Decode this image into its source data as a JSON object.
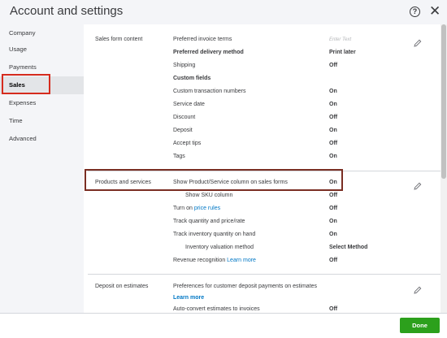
{
  "header": {
    "title": "Account and settings",
    "help_glyph": "?",
    "close_glyph": "✕"
  },
  "sidebar": {
    "items": [
      {
        "label": "Company"
      },
      {
        "label": "Usage"
      },
      {
        "label": "Payments"
      },
      {
        "label": "Sales"
      },
      {
        "label": "Expenses"
      },
      {
        "label": "Time"
      },
      {
        "label": "Advanced"
      }
    ],
    "active": "Sales"
  },
  "sections": {
    "sales_form_content": {
      "title": "Sales form content",
      "rows": [
        {
          "label": "Preferred invoice terms",
          "value": "Enter Text"
        },
        {
          "label": "Preferred delivery method",
          "value": "Print later"
        },
        {
          "label": "Shipping",
          "value": "Off"
        },
        {
          "label": "Custom fields",
          "value": ""
        },
        {
          "label": "Custom transaction numbers",
          "value": "On"
        },
        {
          "label": "Service date",
          "value": "On"
        },
        {
          "label": "Discount",
          "value": "Off"
        },
        {
          "label": "Deposit",
          "value": "On"
        },
        {
          "label": "Accept tips",
          "value": "Off"
        },
        {
          "label": "Tags",
          "value": "On"
        }
      ]
    },
    "products_and_services": {
      "title": "Products and services",
      "rows": [
        {
          "label": "Show Product/Service column on sales forms",
          "value": "On"
        },
        {
          "label": "Show SKU column",
          "value": "Off"
        },
        {
          "label_prefix": "Turn on ",
          "link": "price rules",
          "value": "Off"
        },
        {
          "label": "Track quantity and price/rate",
          "value": "On"
        },
        {
          "label": "Track inventory quantity on hand",
          "value": "On"
        },
        {
          "label": "Inventory valuation method",
          "value": "Select Method"
        },
        {
          "label_prefix": "Revenue recognition ",
          "link": "Learn more",
          "value": "Off"
        }
      ]
    },
    "deposit_on_estimates": {
      "title": "Deposit on estimates",
      "rows": [
        {
          "label": "Preferences for customer deposit payments on estimates",
          "link": "Learn more",
          "value": ""
        },
        {
          "label": "Auto-convert estimates to invoices",
          "value": "Off"
        }
      ]
    }
  },
  "footer": {
    "done_label": "Done"
  },
  "colors": {
    "accent_green": "#2ca01c",
    "link_blue": "#0077c5",
    "highlight_red": "#d52b1e",
    "highlight_brown": "#7a2e23"
  }
}
